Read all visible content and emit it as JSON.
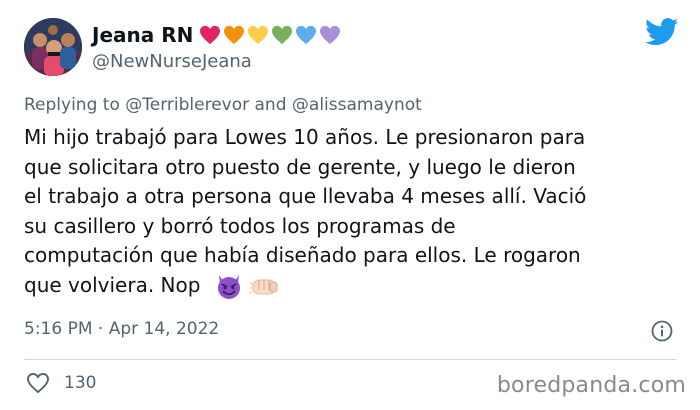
{
  "tweet": {
    "author": {
      "display_name": "Jeana RN",
      "handle": "@NewNurseJeana",
      "avatar_icon": "family-photo-avatar",
      "name_emoji_colors": [
        "#e0245e",
        "#f4900c",
        "#ffcc4d",
        "#78b159",
        "#5dadec",
        "#aa8ed6"
      ]
    },
    "reply": {
      "prefix": "Replying to",
      "mention_1": "@Terriblerevor",
      "conjunction": "and",
      "mention_2": "@alissamaynot"
    },
    "body_text": "Mi hijo trabajó para Lowes 10 años. Le presionaron para\nque solicitara otro puesto de gerente, y luego le dieron\nel trabajo a otra persona que llevaba 4 meses allí. Vació\nsu casillero y borró todos los programas de\ncomputación que había diseñado para ellos. Le rogaron\nque volviera. Nop",
    "emojis": [
      "smiling-devil-emoji",
      "fist-bump-emoji"
    ],
    "timestamp": "5:16 PM · Apr 14, 2022",
    "like_count": "130"
  },
  "colors": {
    "brand_blue": "#1d9bf0",
    "muted_text": "#536471",
    "devil_purple": "#8a4fc9"
  },
  "watermark": "boredpanda.com"
}
